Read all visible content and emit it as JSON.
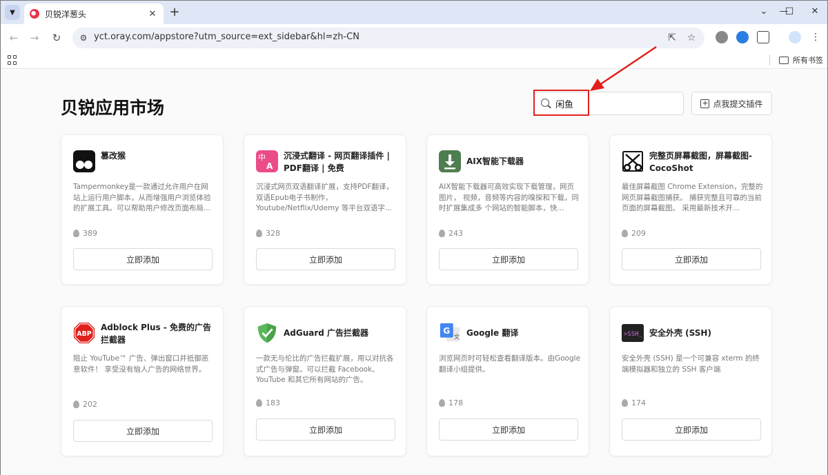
{
  "browser": {
    "tab_title": "贝锐洋葱头",
    "url": "yct.oray.com/appstore?utm_source=ext_sidebar&hl=zh-CN",
    "all_bookmarks": "所有书签"
  },
  "page": {
    "title": "贝锐应用市场",
    "search_value": "闲鱼",
    "submit_label": "点我提交插件",
    "accent_color": "#e0201c"
  },
  "cards": [
    {
      "name": "篡改猴",
      "desc": "Tampermonkey是一款通过允许用户在网站上运行用户脚本，从而增强用户浏览体验的扩展工具。可以帮助用户修改页面布局...",
      "count": "389",
      "button": "立即添加",
      "icon": "tampermonkey-icon"
    },
    {
      "name": "沉浸式翻译 - 网页翻译插件 | PDF翻译 | 免费",
      "desc": "沉浸式网页双语翻译扩展，支持PDF翻译，双语Epub电子书制作，Youtube/Netflix/Udemy 等平台双语字...",
      "count": "328",
      "button": "立即添加",
      "icon": "immersive-translate-icon"
    },
    {
      "name": "AIX智能下载器",
      "desc": "AIX智能下载器可高效实现下载管理，网页图片， 视频，音频等内容的嗅探和下载，同时扩展集成多 个网站的智能脚本，快...",
      "count": "243",
      "button": "立即添加",
      "icon": "download-icon"
    },
    {
      "name": "完整页屏幕截图，屏幕截图-CocoShot",
      "desc": "最佳屏幕截图 Chrome Extension，完整的网页屏幕截图捕获。 捕获完整且可靠的当前页面的屏幕截图。 采用最新技术开...",
      "count": "209",
      "button": "立即添加",
      "icon": "scissors-icon"
    },
    {
      "name": "Adblock Plus - 免费的广告拦截器",
      "desc": "阻止 YouTube™ 广告、弹出窗口并抵御恶意软件！ 享受没有恼人广告的网络世界。",
      "count": "202",
      "button": "立即添加",
      "icon": "abp-icon"
    },
    {
      "name": "AdGuard 广告拦截器",
      "desc": "一款无与伦比的广告拦截扩展，用以对抗各式广告与弹窗。可以拦截 Facebook、YouTube 和其它所有网站的广告。",
      "count": "183",
      "button": "立即添加",
      "icon": "shield-check-icon"
    },
    {
      "name": "Google 翻译",
      "desc": "浏览网页时可轻松查看翻译版本。由Google翻译小组提供。",
      "count": "178",
      "button": "立即添加",
      "icon": "google-translate-icon"
    },
    {
      "name": "安全外壳 (SSH)",
      "desc": "安全外壳 (SSH) 是一个可兼容 xterm 的终端模拟器和独立的 SSH 客户端",
      "count": "174",
      "button": "立即添加",
      "icon": "terminal-icon"
    }
  ]
}
